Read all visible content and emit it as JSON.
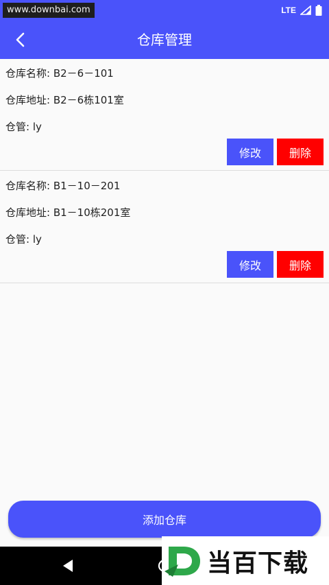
{
  "status_bar": {
    "watermark_text": "www.downbai.com",
    "network": "LTE"
  },
  "toolbar": {
    "title": "仓库管理",
    "back_icon": "chevron-left-icon"
  },
  "warehouses": [
    {
      "name_line": "仓库名称: B2－6－101",
      "address_line": "仓库地址: B2－6栋101室",
      "keeper_line": "仓管: ly",
      "edit_label": "修改",
      "delete_label": "删除"
    },
    {
      "name_line": "仓库名称: B1－10－201",
      "address_line": "仓库地址: B1－10栋201室",
      "keeper_line": "仓管: ly",
      "edit_label": "修改",
      "delete_label": "删除"
    }
  ],
  "add_button": {
    "label": "添加仓库"
  },
  "watermark_logo": {
    "text": "当百下载"
  },
  "colors": {
    "primary": "#4a53fa",
    "danger": "#ff0000",
    "background": "#fafafa"
  }
}
